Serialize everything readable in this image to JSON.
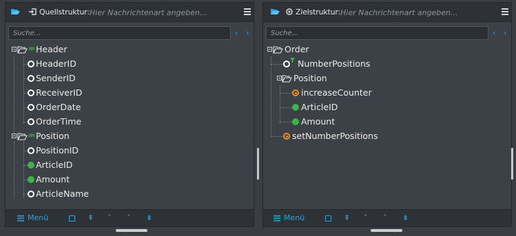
{
  "left": {
    "title": "Quellstruktur:",
    "placeholder": "Hier Nachrichtenart angeben...",
    "search_placeholder": "Suche...",
    "tree": {
      "header": "Header",
      "header_children": [
        "HeaderID",
        "SenderID",
        "ReceiverID",
        "OrderDate",
        "OrderTime"
      ],
      "position": "Position",
      "position_children": [
        "PositionID",
        "ArticleID",
        "Amount",
        "ArticleName"
      ]
    }
  },
  "right": {
    "title": "Zielstruktur:",
    "placeholder": "Hier Nachrichtenart angeben...",
    "search_placeholder": "Suche...",
    "tree": {
      "order": "Order",
      "number_positions": "NumberPositions",
      "position": "Position",
      "position_children": [
        "increaseCounter",
        "ArticleID",
        "Amount"
      ],
      "set_number_positions": "setNumberPositions"
    }
  },
  "footer": {
    "menu_label": "Menü"
  },
  "glyphs": {
    "nav_prev": "‹",
    "nav_next": "›",
    "top": "⇞",
    "up": "˄",
    "down": "˅",
    "bottom": "⇟"
  },
  "colors": {
    "accent": "#29a3e0",
    "green": "#3bb54a",
    "orange": "#f08c1a"
  },
  "icons": [
    "folder-open-icon",
    "import-icon",
    "target-icon",
    "hamburger-icon",
    "search-prev-icon",
    "search-next-icon",
    "folder-icon",
    "collapse-icon",
    "node-ring-icon",
    "node-dot-icon",
    "function-icon",
    "funnel-icon"
  ]
}
